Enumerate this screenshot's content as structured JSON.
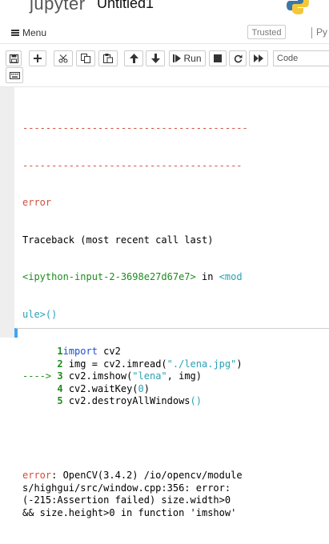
{
  "header": {
    "logo_text": "jupyter",
    "notebook_name": "Untitled1"
  },
  "menubar": {
    "menu_label": "Menu",
    "trusted_label": "Trusted",
    "kernel_label": "Py"
  },
  "toolbar": {
    "run_label": "Run",
    "cell_type": "Code"
  },
  "output": {
    "separator_1": "---------------------------------------",
    "separator_2": "--------------------------------------",
    "error_label": "error",
    "traceback_header": "Traceback (most recent call last)",
    "input_location": "<ipython-input-2-3698e27d67e7>",
    "in_word": " in ",
    "module_part_1": "<mod",
    "module_part_2": "ule>()",
    "code_lines": [
      {
        "prefix": "      ",
        "num": "1",
        "parts": [
          [
            "blue",
            "import"
          ],
          [
            "",
            " cv2"
          ]
        ]
      },
      {
        "prefix": "      ",
        "num": "2",
        "parts": [
          [
            "",
            " img = cv2.imread("
          ],
          [
            "cyan",
            "\"./lena.jpg\""
          ],
          [
            "",
            ")"
          ]
        ]
      },
      {
        "prefix": "----> ",
        "num": "3",
        "parts": [
          [
            "",
            " cv2.imshow("
          ],
          [
            "cyan",
            "\"lena\""
          ],
          [
            "",
            ", img)"
          ]
        ]
      },
      {
        "prefix": "      ",
        "num": "4",
        "parts": [
          [
            "",
            " cv2.waitKey("
          ],
          [
            "cyan",
            "0"
          ],
          [
            "",
            ")"
          ]
        ]
      },
      {
        "prefix": "      ",
        "num": "5",
        "parts": [
          [
            "",
            " cv2.destroyAllWindows"
          ],
          [
            "cyan",
            "()"
          ]
        ]
      }
    ],
    "error_message_lines": [
      "error: OpenCV(3.4.2) /io/opencv/module",
      "s/highgui/src/window.cpp:356: error:",
      "(-215:Assertion failed) size.width>0",
      "&& size.height>0 in function 'imshow'"
    ]
  },
  "colors": {
    "error_red": "#d0503c",
    "line_number_green": "#1e8c1e",
    "string_cyan": "#2aa2b5",
    "keyword_blue": "#1f4fd1",
    "selected_cell_blue": "#42a5f5"
  },
  "icons": [
    "save-icon",
    "plus-icon",
    "scissors-icon",
    "copy-icon",
    "paste-icon",
    "arrow-up-icon",
    "arrow-down-icon",
    "step-forward-icon",
    "stop-icon",
    "restart-icon",
    "fast-forward-icon",
    "keyboard-icon",
    "python-logo-icon"
  ]
}
